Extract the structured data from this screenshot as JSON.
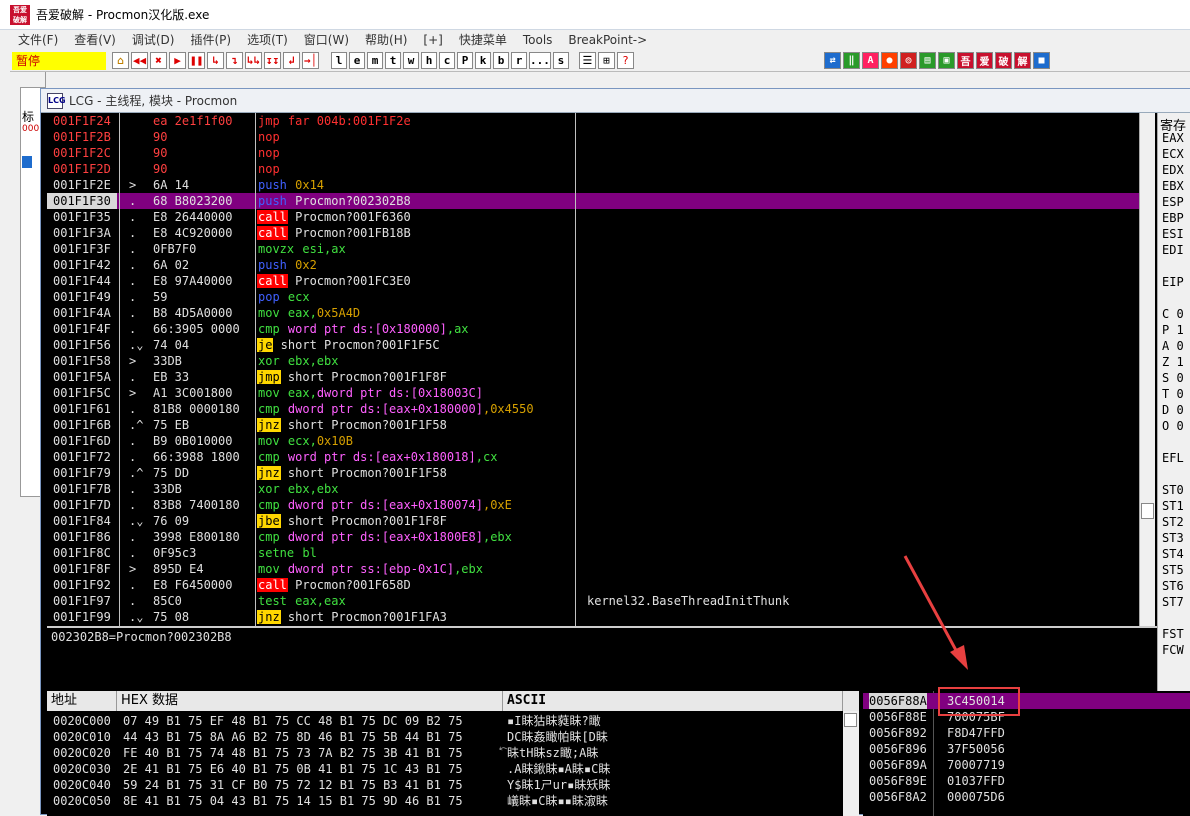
{
  "titlebar": {
    "icon_text": "吾爱破解",
    "title": "吾爱破解 - Procmon汉化版.exe"
  },
  "menu": [
    "文件(F)",
    "查看(V)",
    "调试(D)",
    "插件(P)",
    "选项(T)",
    "窗口(W)",
    "帮助(H)",
    "[+]",
    "快捷菜单",
    "Tools",
    "BreakPoint->"
  ],
  "toolbar": {
    "status": "暂停",
    "buttons": [
      "⌂",
      "◀◀",
      "✖",
      "▶",
      "❚❚",
      "↳",
      "↴",
      "↳↳",
      "↧↧",
      "↲",
      "→│"
    ],
    "letters": [
      "l",
      "e",
      "m",
      "t",
      "w",
      "h",
      "c",
      "P",
      "k",
      "b",
      "r",
      "...",
      "s"
    ],
    "tail": [
      "☰",
      "⊞",
      "?"
    ],
    "right": [
      "⇄",
      "‖",
      "A",
      "●",
      "◎",
      "▤",
      "▣",
      "吾",
      "爱",
      "破",
      "解",
      "■"
    ]
  },
  "cpu_window": {
    "title": "LCG - 主线程, 模块 - Procmon",
    "icon": "LCG"
  },
  "left_pane": {
    "label": "标",
    "red_text": "000"
  },
  "disasm": [
    {
      "addr": "001F1F24",
      "mark": "",
      "hex": "ea 2e1f1f00",
      "asm": [
        [
          "jmp",
          "r"
        ],
        [
          " far 004b:001F1F2e",
          "r"
        ]
      ],
      "red": true
    },
    {
      "addr": "001F1F2B",
      "mark": "",
      "hex": "90",
      "asm": [
        [
          "nop",
          "r"
        ]
      ],
      "red": true
    },
    {
      "addr": "001F1F2C",
      "mark": "",
      "hex": "90",
      "asm": [
        [
          "nop",
          "r"
        ]
      ],
      "red": true
    },
    {
      "addr": "001F1F2D",
      "mark": "",
      "hex": "90",
      "asm": [
        [
          "nop",
          "r"
        ]
      ],
      "red": true
    },
    {
      "addr": "001F1F2E",
      "mark": ">",
      "hex": "6A 14",
      "asm": [
        [
          "push",
          "b"
        ],
        [
          " 0x14",
          "o"
        ]
      ]
    },
    {
      "addr": "001F1F30",
      "mark": ".",
      "hex": "68 B8023200",
      "asm": [
        [
          "push",
          "b"
        ],
        [
          " Procmon?002302B8",
          ""
        ]
      ],
      "sel": true
    },
    {
      "addr": "001F1F35",
      "mark": ".",
      "hex": "E8 26440000",
      "asm": [
        [
          "call",
          "red"
        ],
        [
          " Procmon?001F6360",
          ""
        ]
      ]
    },
    {
      "addr": "001F1F3A",
      "mark": ".",
      "hex": "E8 4C920000",
      "asm": [
        [
          "call",
          "red"
        ],
        [
          " Procmon?001FB18B",
          ""
        ]
      ]
    },
    {
      "addr": "001F1F3F",
      "mark": ".",
      "hex": "0FB7F0",
      "asm": [
        [
          "movzx",
          "g"
        ],
        [
          " esi,ax",
          "g"
        ]
      ]
    },
    {
      "addr": "001F1F42",
      "mark": ".",
      "hex": "6A 02",
      "asm": [
        [
          "push",
          "b"
        ],
        [
          " 0x2",
          "o"
        ]
      ]
    },
    {
      "addr": "001F1F44",
      "mark": ".",
      "hex": "E8 97A40000",
      "asm": [
        [
          "call",
          "red"
        ],
        [
          " Procmon?001FC3E0",
          ""
        ]
      ]
    },
    {
      "addr": "001F1F49",
      "mark": ".",
      "hex": "59",
      "asm": [
        [
          "pop",
          "b"
        ],
        [
          " ecx",
          "g"
        ]
      ]
    },
    {
      "addr": "001F1F4A",
      "mark": ".",
      "hex": "B8 4D5A0000",
      "asm": [
        [
          "mov",
          "g"
        ],
        [
          " eax,",
          "g"
        ],
        [
          "0x5A4D",
          "o"
        ]
      ]
    },
    {
      "addr": "001F1F4F",
      "mark": ".",
      "hex": "66:3905 0000",
      "asm": [
        [
          "cmp",
          "g"
        ],
        [
          " word ptr ",
          "m"
        ],
        [
          "ds:[0x180000]",
          "m"
        ],
        [
          ",ax",
          "g"
        ]
      ]
    },
    {
      "addr": "001F1F56",
      "mark": ".⌄",
      "hex": "74 04",
      "asm": [
        [
          "je",
          "y"
        ],
        [
          " short Procmon?001F1F5C",
          ""
        ]
      ]
    },
    {
      "addr": "001F1F58",
      "mark": ">",
      "hex": "33DB",
      "asm": [
        [
          "xor",
          "g"
        ],
        [
          " ebx,ebx",
          "g"
        ]
      ]
    },
    {
      "addr": "001F1F5A",
      "mark": ".",
      "hex": "EB 33",
      "asm": [
        [
          "jmp",
          "y"
        ],
        [
          " short Procmon?001F1F8F",
          ""
        ]
      ]
    },
    {
      "addr": "001F1F5C",
      "mark": ">",
      "hex": "A1 3C001800",
      "asm": [
        [
          "mov",
          "g"
        ],
        [
          " eax,",
          "g"
        ],
        [
          "dword ptr ds:[0x18003C]",
          "m"
        ]
      ]
    },
    {
      "addr": "001F1F61",
      "mark": ".",
      "hex": "81B8 0000180",
      "asm": [
        [
          "cmp",
          "g"
        ],
        [
          " dword ptr ds:[eax+0x180000]",
          "m"
        ],
        [
          ",0x4550",
          "o"
        ]
      ]
    },
    {
      "addr": "001F1F6B",
      "mark": ".^",
      "hex": "75 EB",
      "asm": [
        [
          "jnz",
          "y"
        ],
        [
          " short Procmon?001F1F58",
          ""
        ]
      ]
    },
    {
      "addr": "001F1F6D",
      "mark": ".",
      "hex": "B9 0B010000",
      "asm": [
        [
          "mov",
          "g"
        ],
        [
          " ecx,",
          "g"
        ],
        [
          "0x10B",
          "o"
        ]
      ]
    },
    {
      "addr": "001F1F72",
      "mark": ".",
      "hex": "66:3988 1800",
      "asm": [
        [
          "cmp",
          "g"
        ],
        [
          " word ptr ds:[eax+0x180018]",
          "m"
        ],
        [
          ",cx",
          "g"
        ]
      ]
    },
    {
      "addr": "001F1F79",
      "mark": ".^",
      "hex": "75 DD",
      "asm": [
        [
          "jnz",
          "y"
        ],
        [
          " short Procmon?001F1F58",
          ""
        ]
      ]
    },
    {
      "addr": "001F1F7B",
      "mark": ".",
      "hex": "33DB",
      "asm": [
        [
          "xor",
          "g"
        ],
        [
          " ebx,ebx",
          "g"
        ]
      ]
    },
    {
      "addr": "001F1F7D",
      "mark": ".",
      "hex": "83B8 7400180",
      "asm": [
        [
          "cmp",
          "g"
        ],
        [
          " dword ptr ds:[eax+0x180074]",
          "m"
        ],
        [
          ",0xE",
          "o"
        ]
      ]
    },
    {
      "addr": "001F1F84",
      "mark": ".⌄",
      "hex": "76 09",
      "asm": [
        [
          "jbe",
          "y"
        ],
        [
          " short Procmon?001F1F8F",
          ""
        ]
      ]
    },
    {
      "addr": "001F1F86",
      "mark": ".",
      "hex": "3998 E800180",
      "asm": [
        [
          "cmp",
          "g"
        ],
        [
          " dword ptr ds:[eax+0x1800E8]",
          "m"
        ],
        [
          ",ebx",
          "g"
        ]
      ]
    },
    {
      "addr": "001F1F8C",
      "mark": ".",
      "hex": "0F95c3",
      "asm": [
        [
          "setne",
          "g"
        ],
        [
          " bl",
          "g"
        ]
      ]
    },
    {
      "addr": "001F1F8F",
      "mark": ">",
      "hex": "895D E4",
      "asm": [
        [
          "mov",
          "g"
        ],
        [
          " dword ptr ss:[ebp-0x1C]",
          "m"
        ],
        [
          ",ebx",
          "g"
        ]
      ]
    },
    {
      "addr": "001F1F92",
      "mark": ".",
      "hex": "E8 F6450000",
      "asm": [
        [
          "call",
          "red"
        ],
        [
          " Procmon?001F658D",
          ""
        ]
      ]
    },
    {
      "addr": "001F1F97",
      "mark": ".",
      "hex": "85C0",
      "asm": [
        [
          "test",
          "g"
        ],
        [
          " eax,eax",
          "g"
        ]
      ],
      "cmt": "kernel32.BaseThreadInitThunk"
    },
    {
      "addr": "001F1F99",
      "mark": ".⌄",
      "hex": "75 08",
      "asm": [
        [
          "jnz",
          "y"
        ],
        [
          " short Procmon?001F1FA3",
          ""
        ]
      ]
    }
  ],
  "info": "002302B8=Procmon?002302B8",
  "registers": {
    "title": "寄存",
    "names": [
      "EAX",
      "ECX",
      "EDX",
      "EBX",
      "ESP",
      "EBP",
      "ESI",
      "EDI",
      "",
      "EIP",
      "",
      "C 0",
      "P 1",
      "A 0",
      "Z 1",
      "S 0",
      "T 0",
      "D 0",
      "O 0",
      "",
      "EFL",
      "",
      "ST0",
      "ST1",
      "ST2",
      "ST3",
      "ST4",
      "ST5",
      "ST6",
      "ST7",
      "",
      "FST",
      "FCW"
    ]
  },
  "dump": {
    "headers": [
      "地址",
      "HEX 数据",
      "ASCII"
    ],
    "rows": [
      {
        "addr": "0020C000",
        "hex": "07 49 B1 75 EF 48 B1 75 CC 48 B1 75 DC 09 B2 75",
        "ascii": "▪I眛狜眛蕤眛?瞰"
      },
      {
        "addr": "0020C010",
        "hex": "44 43 B1 75 8A A6 B2 75 8D 46 B1 75 5B 44 B1 75",
        "ascii": "DC眛姦瞰帕眛[D眛"
      },
      {
        "addr": "0020C020",
        "hex": "FE 40 B1 75 74 48 B1 75 73 7A B2 75 3B 41 B1 75",
        "ascii": "⃔眛tH眛sz瞰;A眛"
      },
      {
        "addr": "0020C030",
        "hex": "2E 41 B1 75 E6 40 B1 75 0B 41 B1 75 1C 43 B1 75",
        "ascii": ".A眛鍬眛▪A眛▪C眛"
      },
      {
        "addr": "0020C040",
        "hex": "59 24 B1 75 31 CF B0 75 72 12 B1 75 B3 41 B1 75",
        "ascii": "Y$眛1ㄕur▪眛矨眛"
      },
      {
        "addr": "0020C050",
        "hex": "8E 41 B1 75 04 43 B1 75 14 15 B1 75 9D 46 B1 75",
        "ascii": "嶬眛▪C眛▪▪眛漃眛"
      }
    ]
  },
  "stack": [
    {
      "addr": "0056F88A",
      "val": "3C450014",
      "sel": true
    },
    {
      "addr": "0056F88E",
      "val": "700075BF"
    },
    {
      "addr": "0056F892",
      "val": "F8D47FFD"
    },
    {
      "addr": "0056F896",
      "val": "37F50056"
    },
    {
      "addr": "0056F89A",
      "val": "70007719"
    },
    {
      "addr": "0056F89E",
      "val": "01037FFD"
    },
    {
      "addr": "0056F8A2",
      "val": "000075D6"
    }
  ],
  "colors": {
    "selection": "#800080",
    "call_bg": "#ff0000",
    "jump_bg": "#ffd700",
    "status_bg": "#ffff00",
    "annotation": "#e84040"
  }
}
